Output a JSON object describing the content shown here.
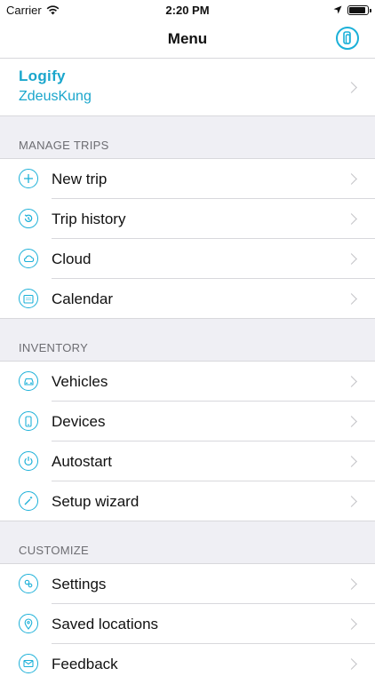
{
  "status_bar": {
    "carrier": "Carrier",
    "time": "2:20 PM"
  },
  "nav": {
    "title": "Menu"
  },
  "account": {
    "app_name": "Logify",
    "username": "ZdeusKung"
  },
  "sections": [
    {
      "header": "MANAGE TRIPS",
      "items": [
        {
          "label": "New trip",
          "icon": "plus-icon"
        },
        {
          "label": "Trip history",
          "icon": "history-icon"
        },
        {
          "label": "Cloud",
          "icon": "cloud-icon"
        },
        {
          "label": "Calendar",
          "icon": "calendar-icon"
        }
      ]
    },
    {
      "header": "INVENTORY",
      "items": [
        {
          "label": "Vehicles",
          "icon": "car-icon"
        },
        {
          "label": "Devices",
          "icon": "phone-icon"
        },
        {
          "label": "Autostart",
          "icon": "power-icon"
        },
        {
          "label": "Setup wizard",
          "icon": "wand-icon"
        }
      ]
    },
    {
      "header": "CUSTOMIZE",
      "items": [
        {
          "label": "Settings",
          "icon": "gear-icon"
        },
        {
          "label": "Saved locations",
          "icon": "location-pin-icon"
        },
        {
          "label": "Feedback",
          "icon": "mail-icon"
        }
      ]
    }
  ],
  "colors": {
    "accent": "#1bb0d8",
    "group_background": "#efeff4",
    "separator": "#d8d8dc"
  }
}
